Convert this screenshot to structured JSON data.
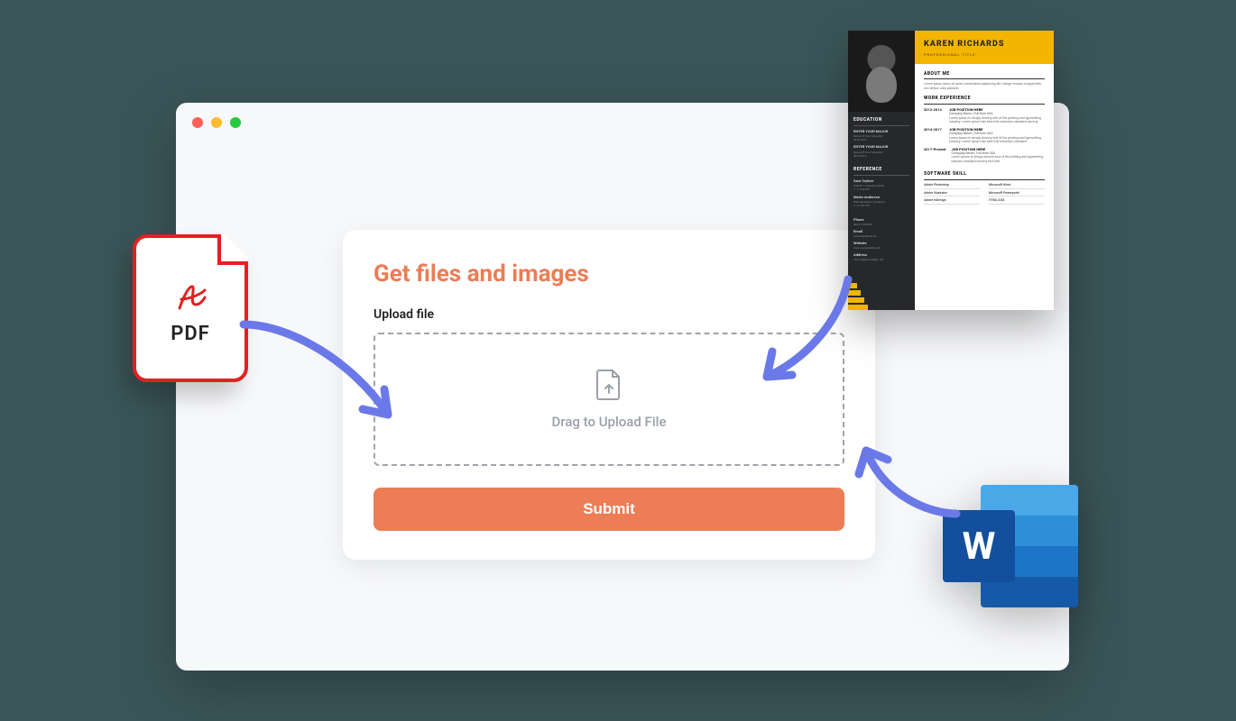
{
  "card": {
    "title": "Get files and images",
    "field_label": "Upload file",
    "dropzone_text": "Drag to Upload File",
    "submit_label": "Submit"
  },
  "pdf": {
    "label": "PDF"
  },
  "word": {
    "letter": "W"
  },
  "resume": {
    "name": "KAREN RICHARDS",
    "role": "PROFESSIONAL TITLE",
    "about_title": "ABOUT ME",
    "about_text": "Lorem ipsum dolor sit amet, consectetur adipiscing elit. Integer tempor congue felis, nec dictum odio placerat.",
    "education_title": "EDUCATION",
    "education": [
      {
        "major": "ENTER YOUR MAJOR",
        "uni": "Name Of Your University",
        "dates": "2010-2013"
      },
      {
        "major": "ENTER YOUR MAJOR",
        "uni": "Name Of Your University",
        "dates": "2013-2015"
      }
    ],
    "reference_title": "REFERENCE",
    "references": [
      {
        "name": "Sara Taylore",
        "role": "Director | Company Name",
        "phone": "T: +1 234 567"
      },
      {
        "name": "Micke Anderson",
        "role": "Web Developer | Company",
        "phone": "T: +1 234 567"
      }
    ],
    "contact": {
      "phone_label": "Phone",
      "phone": "004-12-3456-89",
      "email_label": "Email",
      "email": "urname@gmail.net",
      "website_label": "Website",
      "website": "www.yourwebsite.com",
      "address_label": "Address",
      "address": "769 Prudence Street - 48"
    },
    "work_title": "WORK EXPERIENCE",
    "work": [
      {
        "years": "2012-2014",
        "position": "JOB POSITION HERE",
        "company": "Company Name | Full-time USA",
        "desc": "Lorem ipsum is simply dummy text of the printing and typesetting industry. Lorem ipsum has been the industry's standard dummy."
      },
      {
        "years": "2014-2017",
        "position": "JOB POSITION HERE",
        "company": "Company Name | Full-time USA",
        "desc": "Lorem ipsum is simply dummy text of the printing and typesetting industry. Lorem ipsum has been the industry's standard."
      },
      {
        "years": "2017-Present",
        "position": "JOB POSITION HERE",
        "company": "Company Name | Full-time USA",
        "desc": "Lorem ipsum is simply dummy text of the printing and typesetting industry standard dummy text ever."
      }
    ],
    "skill_title": "SOFTWARE SKILL",
    "skills": [
      {
        "name": "Adobe Photoshop",
        "name2": "Microsoft Word"
      },
      {
        "name": "Adobe Illustrator",
        "name2": "Microsoft Powerpoint"
      },
      {
        "name": "Adobe InDesign",
        "name2": "HTML/CSS"
      }
    ]
  }
}
